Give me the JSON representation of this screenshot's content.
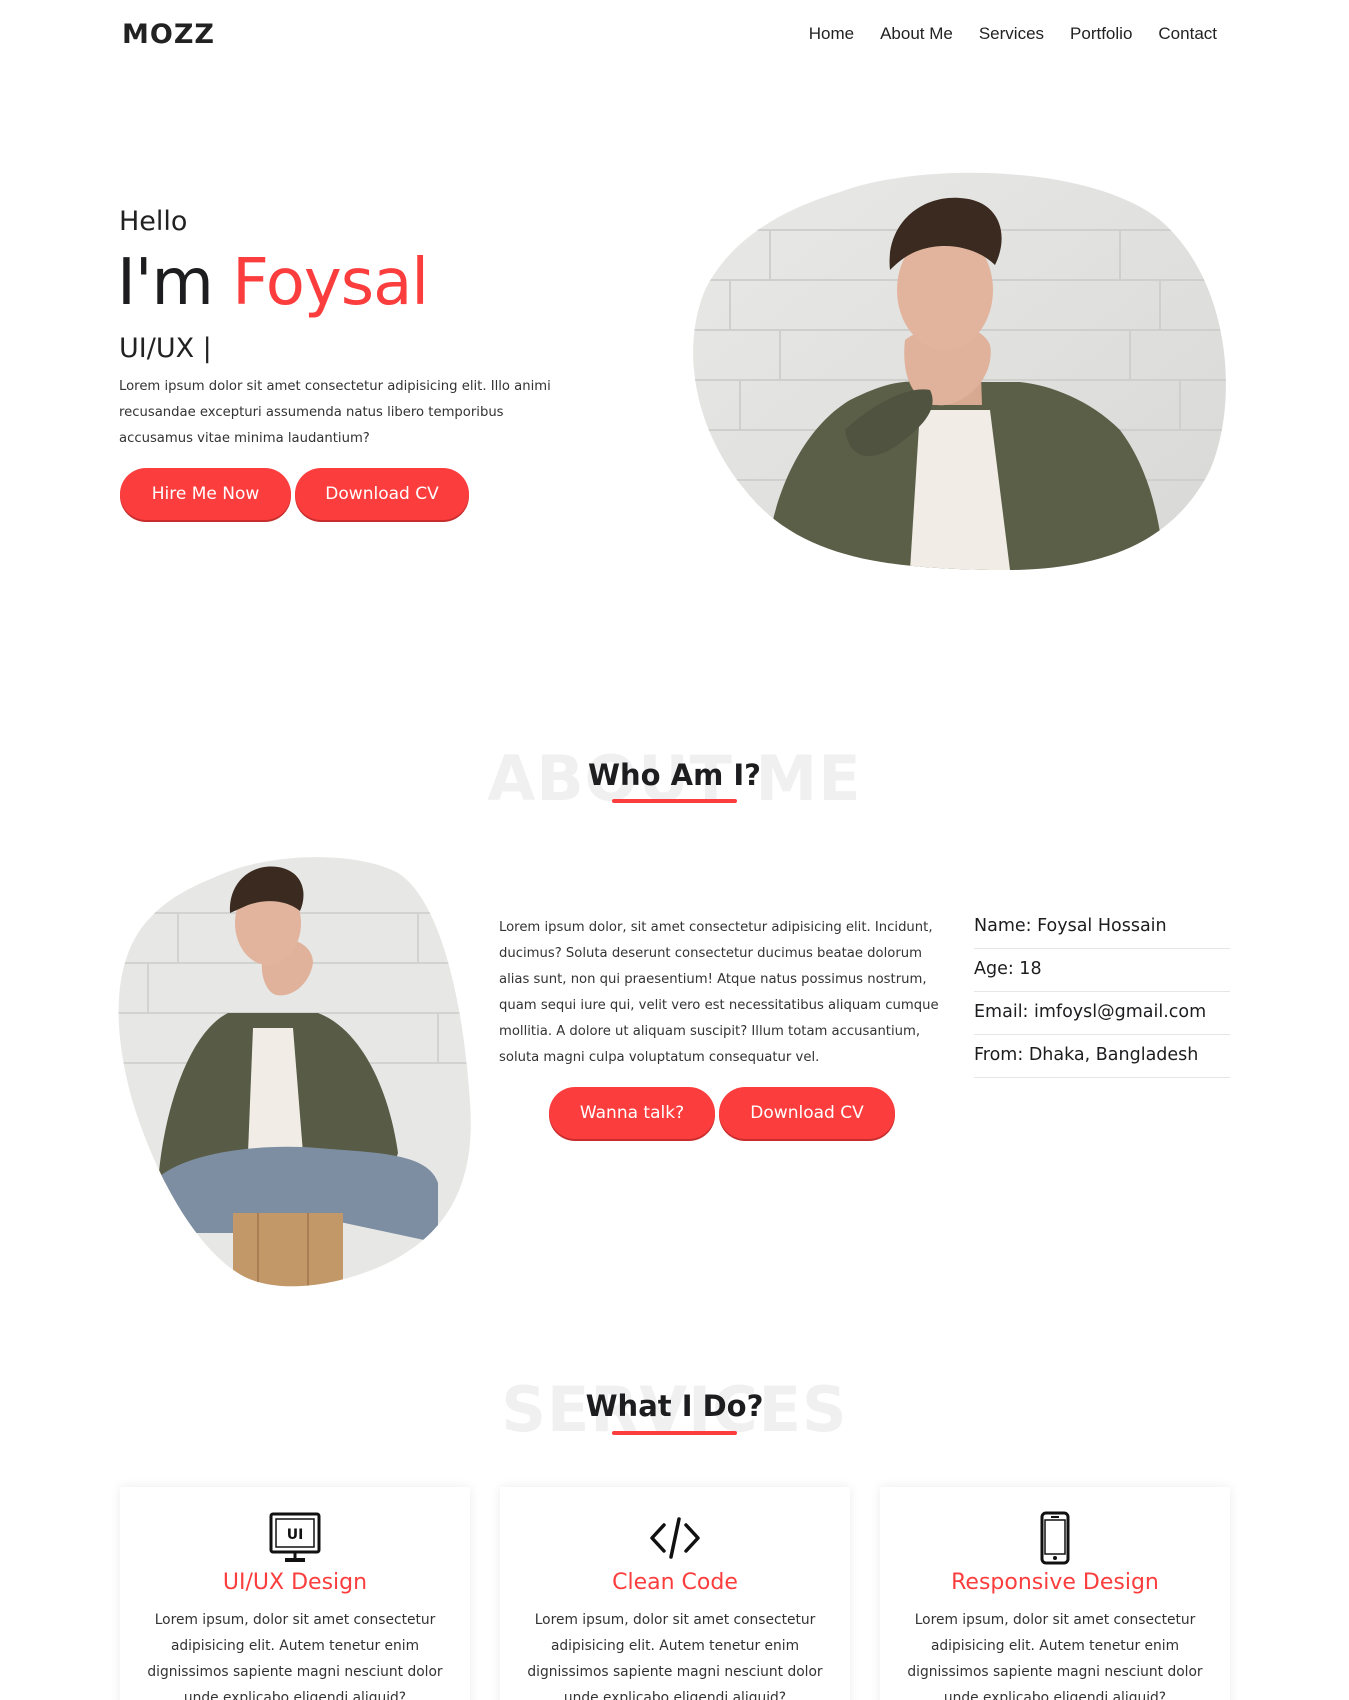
{
  "brand": {
    "logo": "MOZZ",
    "accent_color": "#fc3d3d"
  },
  "nav": {
    "items": [
      {
        "label": "Home"
      },
      {
        "label": "About Me"
      },
      {
        "label": "Services"
      },
      {
        "label": "Portfolio"
      },
      {
        "label": "Contact"
      }
    ]
  },
  "hero": {
    "greeting": "Hello",
    "title_prefix": "I'm",
    "name": "Foysal",
    "role": "UI/UX |",
    "description": "Lorem ipsum dolor sit amet consectetur adipisicing elit. Illo animi recusandae excepturi assumenda natus libero temporibus accusamus vitae minima laudantium?",
    "hire_button": "Hire Me Now",
    "cv_button": "Download CV",
    "image_icon": "portrait-photo"
  },
  "about": {
    "bg_text": "ABOUT ME",
    "heading": "Who Am I?",
    "paragraph": "Lorem ipsum dolor, sit amet consectetur adipisicing elit. Incidunt, ducimus? Soluta deserunt consectetur ducimus beatae dolorum alias sunt, non qui praesentium! Atque natus possimus nostrum, quam sequi iure qui, velit vero est necessitatibus aliquam cumque mollitia. A dolore ut aliquam suscipit? Illum totam accusantium, soluta magni culpa voluptatum consequatur vel.",
    "talk_button": "Wanna talk?",
    "cv_button": "Download CV",
    "info": [
      {
        "label": "Name: Foysal Hossain"
      },
      {
        "label": "Age: 18"
      },
      {
        "label": "Email: imfoysl@gmail.com"
      },
      {
        "label": "From: Dhaka, Bangladesh"
      }
    ]
  },
  "services": {
    "bg_text": "SERVICES",
    "heading": "What I Do?",
    "cards": [
      {
        "icon": "monitor-ui-icon",
        "icon_text": "UI",
        "title": "UI/UX Design",
        "text": "Lorem ipsum, dolor sit amet consectetur adipisicing elit. Autem tenetur enim dignissimos sapiente magni nesciunt dolor unde explicabo eligendi aliquid?"
      },
      {
        "icon": "code-icon",
        "title": "Clean Code",
        "text": "Lorem ipsum, dolor sit amet consectetur adipisicing elit. Autem tenetur enim dignissimos sapiente magni nesciunt dolor unde explicabo eligendi aliquid?"
      },
      {
        "icon": "mobile-phone-icon",
        "title": "Responsive Design",
        "text": "Lorem ipsum, dolor sit amet consectetur adipisicing elit. Autem tenetur enim dignissimos sapiente magni nesciunt dolor unde explicabo eligendi aliquid?"
      }
    ]
  }
}
